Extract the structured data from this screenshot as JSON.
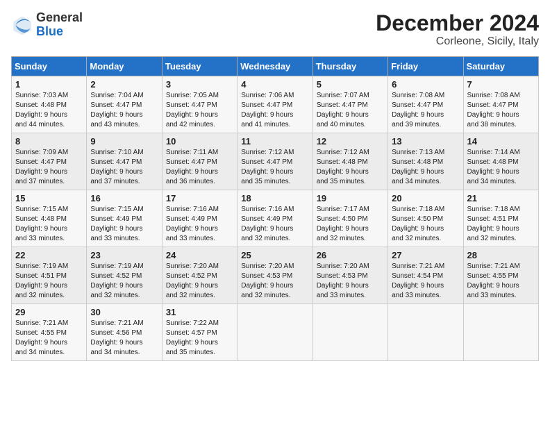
{
  "logo": {
    "general": "General",
    "blue": "Blue"
  },
  "title": "December 2024",
  "location": "Corleone, Sicily, Italy",
  "days_of_week": [
    "Sunday",
    "Monday",
    "Tuesday",
    "Wednesday",
    "Thursday",
    "Friday",
    "Saturday"
  ],
  "weeks": [
    [
      {
        "day": "1",
        "sunrise": "7:03 AM",
        "sunset": "4:48 PM",
        "daylight": "9 hours and 44 minutes."
      },
      {
        "day": "2",
        "sunrise": "7:04 AM",
        "sunset": "4:47 PM",
        "daylight": "9 hours and 43 minutes."
      },
      {
        "day": "3",
        "sunrise": "7:05 AM",
        "sunset": "4:47 PM",
        "daylight": "9 hours and 42 minutes."
      },
      {
        "day": "4",
        "sunrise": "7:06 AM",
        "sunset": "4:47 PM",
        "daylight": "9 hours and 41 minutes."
      },
      {
        "day": "5",
        "sunrise": "7:07 AM",
        "sunset": "4:47 PM",
        "daylight": "9 hours and 40 minutes."
      },
      {
        "day": "6",
        "sunrise": "7:08 AM",
        "sunset": "4:47 PM",
        "daylight": "9 hours and 39 minutes."
      },
      {
        "day": "7",
        "sunrise": "7:08 AM",
        "sunset": "4:47 PM",
        "daylight": "9 hours and 38 minutes."
      }
    ],
    [
      {
        "day": "8",
        "sunrise": "7:09 AM",
        "sunset": "4:47 PM",
        "daylight": "9 hours and 37 minutes."
      },
      {
        "day": "9",
        "sunrise": "7:10 AM",
        "sunset": "4:47 PM",
        "daylight": "9 hours and 37 minutes."
      },
      {
        "day": "10",
        "sunrise": "7:11 AM",
        "sunset": "4:47 PM",
        "daylight": "9 hours and 36 minutes."
      },
      {
        "day": "11",
        "sunrise": "7:12 AM",
        "sunset": "4:47 PM",
        "daylight": "9 hours and 35 minutes."
      },
      {
        "day": "12",
        "sunrise": "7:12 AM",
        "sunset": "4:48 PM",
        "daylight": "9 hours and 35 minutes."
      },
      {
        "day": "13",
        "sunrise": "7:13 AM",
        "sunset": "4:48 PM",
        "daylight": "9 hours and 34 minutes."
      },
      {
        "day": "14",
        "sunrise": "7:14 AM",
        "sunset": "4:48 PM",
        "daylight": "9 hours and 34 minutes."
      }
    ],
    [
      {
        "day": "15",
        "sunrise": "7:15 AM",
        "sunset": "4:48 PM",
        "daylight": "9 hours and 33 minutes."
      },
      {
        "day": "16",
        "sunrise": "7:15 AM",
        "sunset": "4:49 PM",
        "daylight": "9 hours and 33 minutes."
      },
      {
        "day": "17",
        "sunrise": "7:16 AM",
        "sunset": "4:49 PM",
        "daylight": "9 hours and 33 minutes."
      },
      {
        "day": "18",
        "sunrise": "7:16 AM",
        "sunset": "4:49 PM",
        "daylight": "9 hours and 32 minutes."
      },
      {
        "day": "19",
        "sunrise": "7:17 AM",
        "sunset": "4:50 PM",
        "daylight": "9 hours and 32 minutes."
      },
      {
        "day": "20",
        "sunrise": "7:18 AM",
        "sunset": "4:50 PM",
        "daylight": "9 hours and 32 minutes."
      },
      {
        "day": "21",
        "sunrise": "7:18 AM",
        "sunset": "4:51 PM",
        "daylight": "9 hours and 32 minutes."
      }
    ],
    [
      {
        "day": "22",
        "sunrise": "7:19 AM",
        "sunset": "4:51 PM",
        "daylight": "9 hours and 32 minutes."
      },
      {
        "day": "23",
        "sunrise": "7:19 AM",
        "sunset": "4:52 PM",
        "daylight": "9 hours and 32 minutes."
      },
      {
        "day": "24",
        "sunrise": "7:20 AM",
        "sunset": "4:52 PM",
        "daylight": "9 hours and 32 minutes."
      },
      {
        "day": "25",
        "sunrise": "7:20 AM",
        "sunset": "4:53 PM",
        "daylight": "9 hours and 32 minutes."
      },
      {
        "day": "26",
        "sunrise": "7:20 AM",
        "sunset": "4:53 PM",
        "daylight": "9 hours and 33 minutes."
      },
      {
        "day": "27",
        "sunrise": "7:21 AM",
        "sunset": "4:54 PM",
        "daylight": "9 hours and 33 minutes."
      },
      {
        "day": "28",
        "sunrise": "7:21 AM",
        "sunset": "4:55 PM",
        "daylight": "9 hours and 33 minutes."
      }
    ],
    [
      {
        "day": "29",
        "sunrise": "7:21 AM",
        "sunset": "4:55 PM",
        "daylight": "9 hours and 34 minutes."
      },
      {
        "day": "30",
        "sunrise": "7:21 AM",
        "sunset": "4:56 PM",
        "daylight": "9 hours and 34 minutes."
      },
      {
        "day": "31",
        "sunrise": "7:22 AM",
        "sunset": "4:57 PM",
        "daylight": "9 hours and 35 minutes."
      },
      null,
      null,
      null,
      null
    ]
  ],
  "labels": {
    "sunrise": "Sunrise:",
    "sunset": "Sunset:",
    "daylight": "Daylight:"
  }
}
